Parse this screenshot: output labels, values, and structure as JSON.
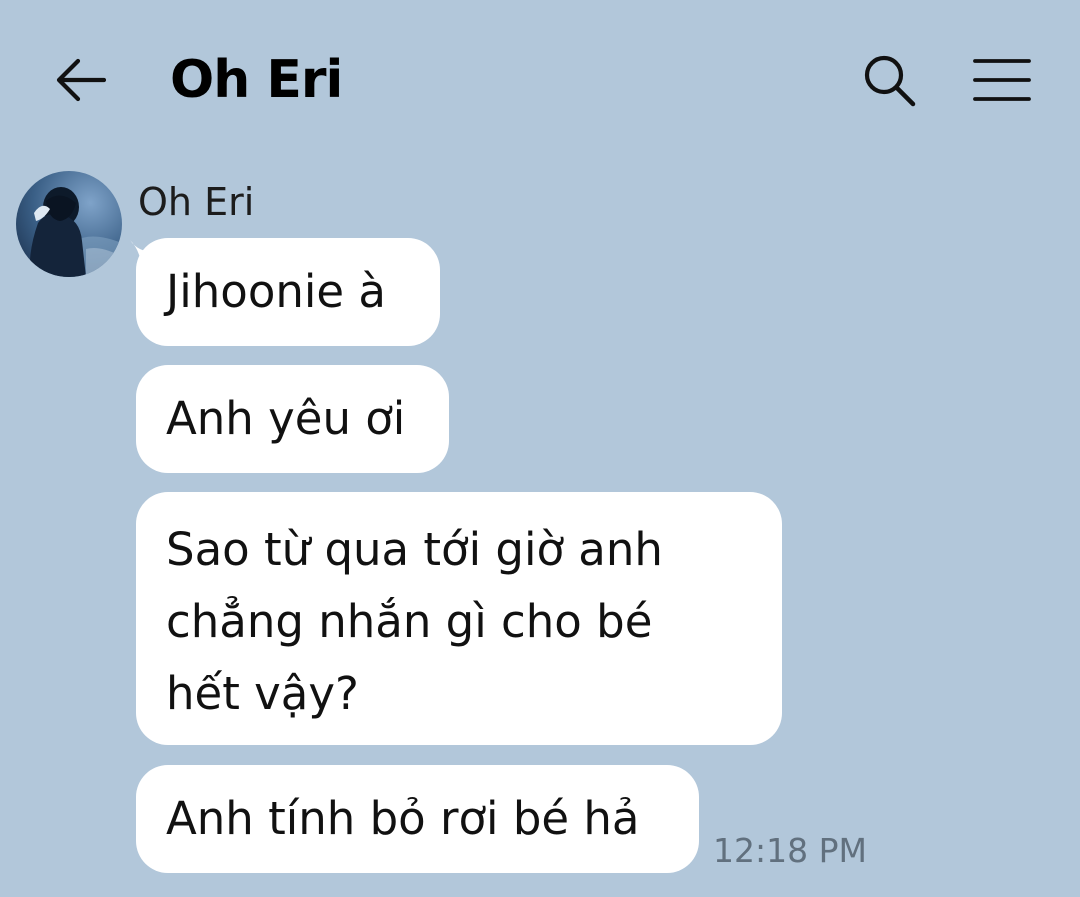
{
  "header": {
    "title": "Oh Eri",
    "back_icon": "arrow-left-icon",
    "search_icon": "search-icon",
    "menu_icon": "hamburger-menu-icon"
  },
  "chat": {
    "background_color": "#b2c7da",
    "bubble_color": "#ffffff",
    "sender": {
      "name": "Oh Eri",
      "avatar_icon": "avatar-photo"
    },
    "messages": [
      {
        "lines": [
          "Jihoonie à"
        ]
      },
      {
        "lines": [
          "Anh yêu ơi"
        ]
      },
      {
        "lines": [
          "Sao từ qua tới giờ anh",
          "chẳng nhắn gì cho bé",
          "hết vậy?"
        ]
      },
      {
        "lines": [
          "Anh tính bỏ rơi bé hả"
        ]
      }
    ],
    "timestamp": "12:18 PM"
  }
}
